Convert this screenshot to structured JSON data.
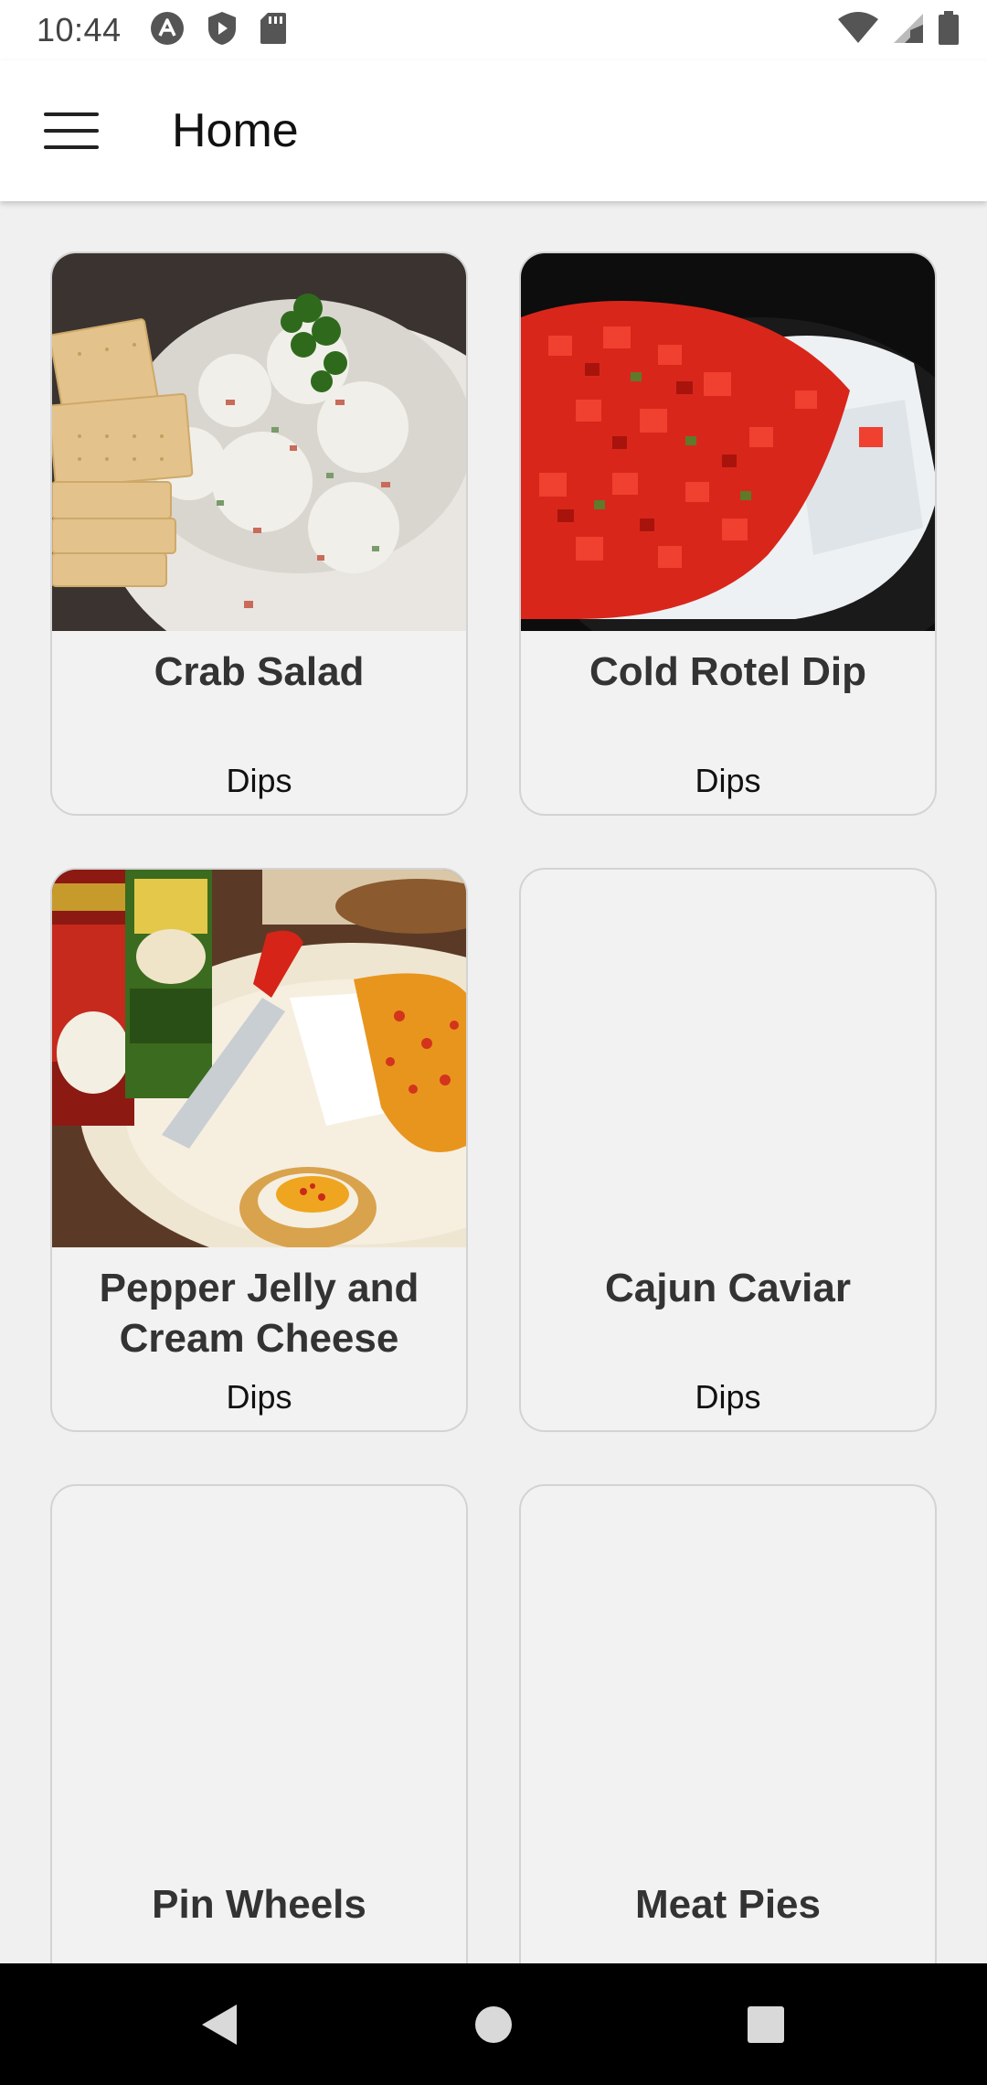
{
  "status_bar": {
    "time": "10:44",
    "left_icons": [
      "a-circle-icon",
      "play-shield-icon",
      "sd-card-icon"
    ],
    "right_icons": [
      "wifi-icon",
      "signal-icon",
      "battery-icon"
    ]
  },
  "app_bar": {
    "menu_icon": "hamburger-menu-icon",
    "title": "Home"
  },
  "recipes": [
    {
      "title": "Crab Salad",
      "category": "Dips",
      "has_image": true
    },
    {
      "title": "Cold Rotel Dip",
      "category": "Dips",
      "has_image": true
    },
    {
      "title": "Pepper Jelly and Cream Cheese",
      "category": "Dips",
      "has_image": true
    },
    {
      "title": "Cajun Caviar",
      "category": "Dips",
      "has_image": false
    },
    {
      "title": "Pin Wheels",
      "category": "",
      "has_image": false
    },
    {
      "title": "Meat Pies",
      "category": "",
      "has_image": false
    }
  ],
  "nav_bar": {
    "buttons": [
      "back-icon",
      "home-icon",
      "recents-icon"
    ]
  },
  "colors": {
    "background": "#f0f0f0",
    "card_background": "#f2f2f2",
    "card_border": "#d3d3d3",
    "nav_bar": "#000000"
  }
}
